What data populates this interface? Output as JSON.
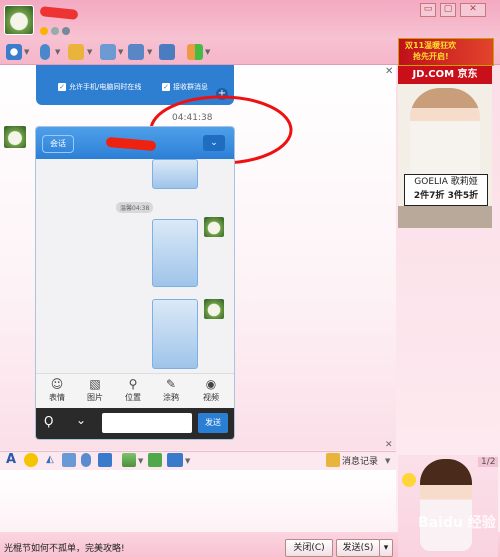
{
  "window": {
    "minimize_label": "▭",
    "close_label": "✕"
  },
  "toolbar": {
    "icons": [
      "camera-icon",
      "microphone-icon",
      "folder-icon",
      "share-icon",
      "screen-icon",
      "monitor-icon",
      "apps-icon"
    ]
  },
  "chat": {
    "option_1": "允许手机/电脑同时在线",
    "option_2": "接收群消息",
    "timestamp": "04:41:38",
    "close_x": "✕"
  },
  "phone": {
    "back_label": "会话",
    "menu_label": "⌄",
    "time_chip": "温馨04:38",
    "tools": [
      {
        "label": "表情",
        "glyph": "☺"
      },
      {
        "label": "图片",
        "glyph": "▧"
      },
      {
        "label": "位置",
        "glyph": "⚲"
      },
      {
        "label": "涂鸦",
        "glyph": "✎"
      },
      {
        "label": "视频",
        "glyph": "◉"
      }
    ],
    "voice_glyph": "Ϙ",
    "chevron_glyph": "⌄",
    "send_label": "发送"
  },
  "input_toolbar": {
    "font_glyph": "A",
    "message_log_label": "消息记录"
  },
  "bottom": {
    "promo_text": "光棍节如何不孤单，完美攻略!",
    "close_button": "关闭(C)",
    "send_button": "发送(S)",
    "send_dropdown": "▾"
  },
  "ads": {
    "ad1_text_line1": "双11温暖狂欢",
    "ad1_text_line2": "抢先开启!",
    "ad2_header": "JD.COM 京东",
    "ad2_brand": "GOELIA 歌莉娅",
    "ad2_offer": "2件7折 3件5折",
    "ad3_page": "1/2"
  },
  "watermark": "Baidu 经验"
}
